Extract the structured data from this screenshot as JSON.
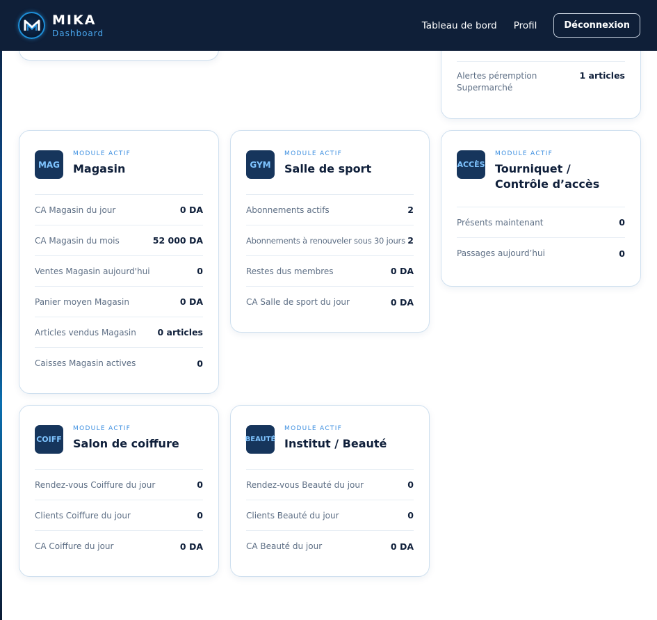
{
  "nav": {
    "brand_name": "MIKA",
    "brand_sub": "Dashboard",
    "links": [
      "Tableau de bord",
      "Profil"
    ],
    "logout_label": "Déconnexion"
  },
  "partial_top_right": {
    "alert_label": "Alertes péremption Supermarché",
    "alert_value": "1 articles"
  },
  "modules": [
    {
      "icon": "MAG",
      "label": "MODULE ACTIF",
      "title": "Magasin",
      "rows": [
        {
          "label": "CA Magasin du jour",
          "value": "0 DA"
        },
        {
          "label": "CA Magasin du mois",
          "value": "52 000 DA"
        },
        {
          "label": "Ventes Magasin aujourd'hui",
          "value": "0"
        },
        {
          "label": "Panier moyen Magasin",
          "value": "0 DA"
        },
        {
          "label": "Articles vendus Magasin",
          "value": "0 articles"
        },
        {
          "label": "Caisses Magasin actives",
          "value": "0"
        }
      ]
    },
    {
      "icon": "GYM",
      "label": "MODULE ACTIF",
      "title": "Salle de sport",
      "rows": [
        {
          "label": "Abonnements actifs",
          "value": "2"
        },
        {
          "label": "Abonnements à renouveler sous 30 jours",
          "value": "2"
        },
        {
          "label": "Restes dus membres",
          "value": "0 DA"
        },
        {
          "label": "CA Salle de sport du jour",
          "value": "0 DA"
        }
      ]
    },
    {
      "icon": "ACCÈS",
      "label": "MODULE ACTIF",
      "title": "Tourniquet / Contrôle d’accès",
      "rows": [
        {
          "label": "Présents maintenant",
          "value": "0"
        },
        {
          "label": "Passages aujourd’hui",
          "value": "0"
        }
      ]
    },
    {
      "icon": "COIFF",
      "label": "MODULE ACTIF",
      "title": "Salon de coiffure",
      "rows": [
        {
          "label": "Rendez-vous Coiffure du jour",
          "value": "0"
        },
        {
          "label": "Clients Coiffure du jour",
          "value": "0"
        },
        {
          "label": "CA Coiffure du jour",
          "value": "0 DA"
        }
      ]
    },
    {
      "icon": "BEAUTÉ",
      "label": "MODULE ACTIF",
      "title": "Institut / Beauté",
      "rows": [
        {
          "label": "Rendez-vous Beauté du jour",
          "value": "0"
        },
        {
          "label": "Clients Beauté du jour",
          "value": "0"
        },
        {
          "label": "CA Beauté du jour",
          "value": "0 DA"
        }
      ]
    }
  ],
  "colors": {
    "navbar_bg": "#0f1f38",
    "accent": "#3d8fe0",
    "icon_bg": "#16355c",
    "card_border": "#cfe0ef"
  }
}
